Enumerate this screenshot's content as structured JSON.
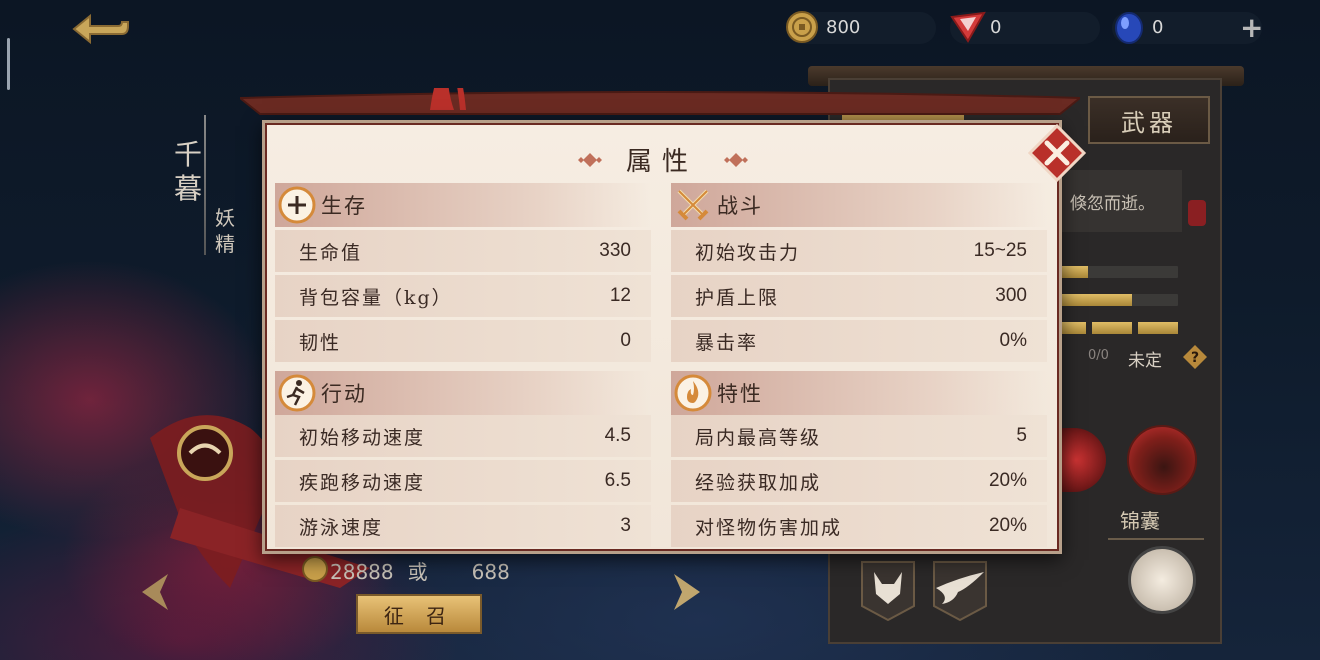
{
  "currency": {
    "gold": "800",
    "red_gem": "0",
    "blue_gem": "0"
  },
  "character": {
    "name": "千暮",
    "type": "妖精"
  },
  "right_panel": {
    "weapon_tab": "武器",
    "description_fragment": "倏忽而逝。",
    "progress_fraction": "0/0",
    "status": "未定",
    "pouch_label": "锦囊"
  },
  "summon": {
    "cost_gold": "28888",
    "or": "或",
    "cost_gem": "688",
    "button": "征 召"
  },
  "modal": {
    "title": "属性",
    "survival": {
      "header": "生存",
      "rows": [
        {
          "key": "生命值",
          "value": "330"
        },
        {
          "key": "背包容量（kg）",
          "value": "12"
        },
        {
          "key": "韧性",
          "value": "0"
        }
      ]
    },
    "combat": {
      "header": "战斗",
      "rows": [
        {
          "key": "初始攻击力",
          "value": "15~25"
        },
        {
          "key": "护盾上限",
          "value": "300"
        },
        {
          "key": "暴击率",
          "value": "0%"
        }
      ]
    },
    "movement": {
      "header": "行动",
      "rows": [
        {
          "key": "初始移动速度",
          "value": "4.5"
        },
        {
          "key": "疾跑移动速度",
          "value": "6.5"
        },
        {
          "key": "游泳速度",
          "value": "3"
        }
      ]
    },
    "traits": {
      "header": "特性",
      "rows": [
        {
          "key": "局内最高等级",
          "value": "5"
        },
        {
          "key": "经验获取加成",
          "value": "20%"
        },
        {
          "key": "对怪物伤害加成",
          "value": "20%"
        }
      ]
    }
  },
  "colors": {
    "accent_red": "#b9302a",
    "gold": "#c9a65a",
    "modal_bg": "#f1e6d9"
  },
  "icons": {
    "back": "back-arrow-icon",
    "gold": "gold-coin-icon",
    "red_gem": "red-gem-icon",
    "blue_gem": "blue-gem-icon",
    "plus": "plus-icon",
    "close": "close-icon",
    "survival": "survival-plus-icon",
    "combat": "crossed-swords-icon",
    "movement": "running-icon",
    "traits": "flame-icon"
  }
}
